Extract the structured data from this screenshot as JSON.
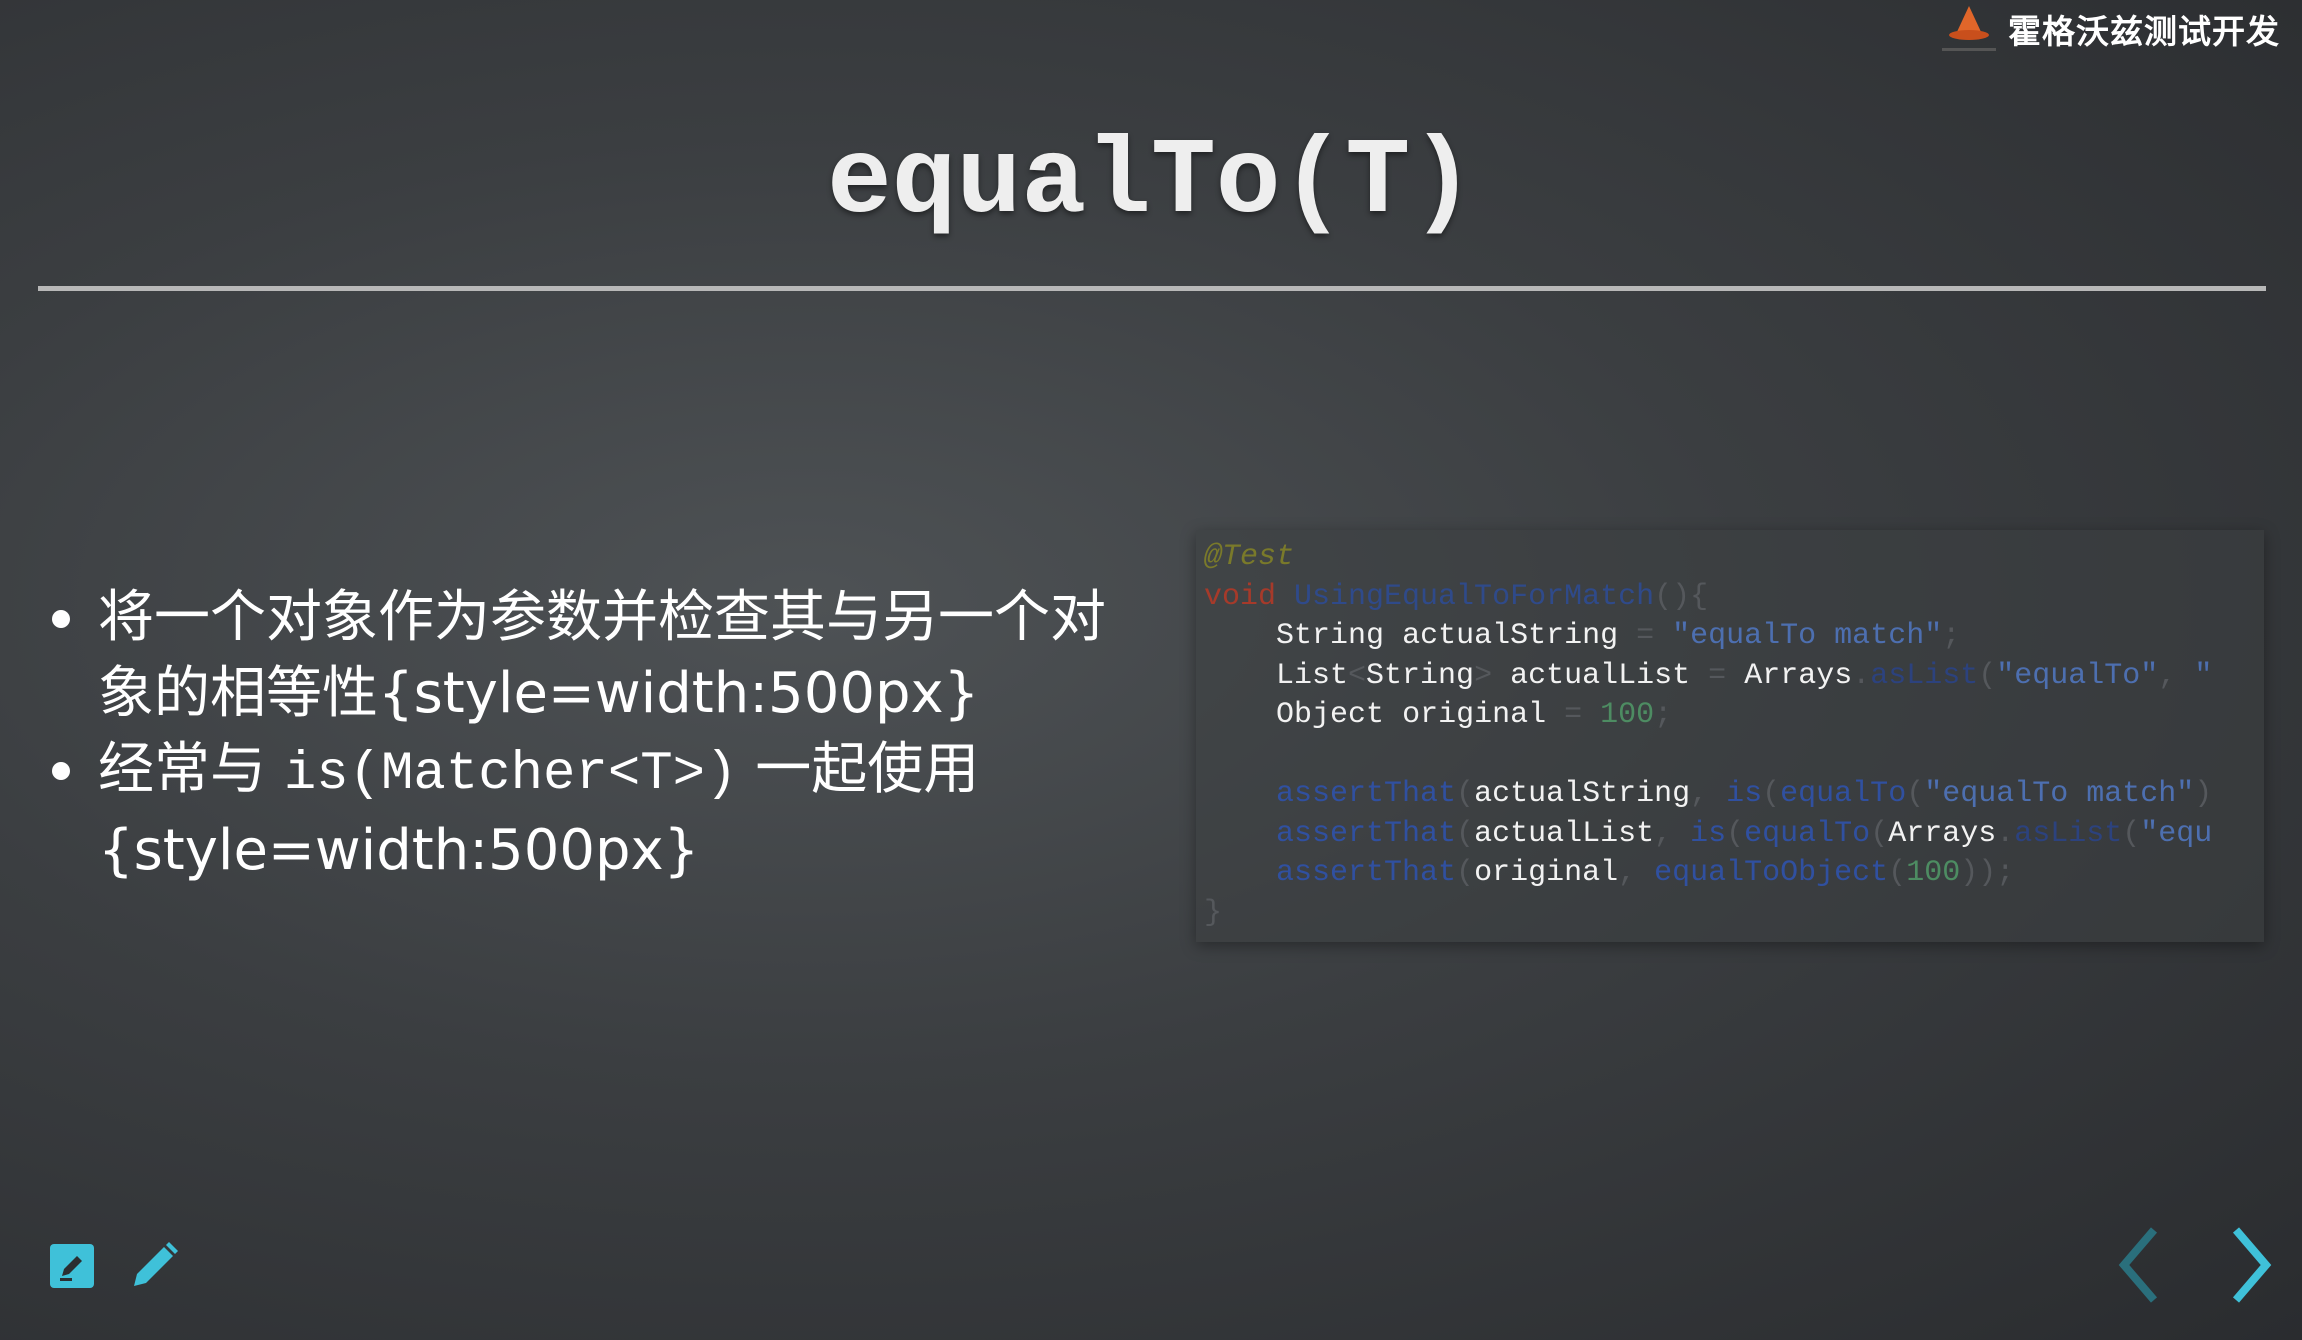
{
  "brand": {
    "name": "霍格沃兹测试开发",
    "logo_icon": "wizard-hat-logo"
  },
  "slide": {
    "title": "equalTo(T)",
    "bullets": [
      {
        "text": "将一个对象作为参数并检查其与另一个对象的相等性{style=width:500px}"
      },
      {
        "prefix": "经常与 ",
        "code": "is(Matcher<T>)",
        "suffix": " 一起使用{style=width:500px}"
      }
    ]
  },
  "code": {
    "lines": [
      "@Test",
      "void UsingEqualToForMatch(){",
      "    String actualString = \"equalTo match\";",
      "    List<String> actualList = Arrays.asList(\"equalTo\", \"",
      "    Object original = 100;",
      "",
      "    assertThat(actualString, is(equalTo(\"equalTo match\")",
      "    assertThat(actualList, is(equalTo(Arrays.asList(\"equ",
      "    assertThat(original, equalToObject(100));",
      "}"
    ]
  },
  "toolbar": {
    "left_icons": [
      "edit-note-icon",
      "pencil-icon"
    ]
  },
  "navigation": {
    "prev_icon": "chevron-left-icon",
    "next_icon": "chevron-right-icon"
  },
  "colors": {
    "accent": "#3fc1d9",
    "nav_disabled": "#2a6f7c",
    "title_rule": "#b8b8b8"
  }
}
